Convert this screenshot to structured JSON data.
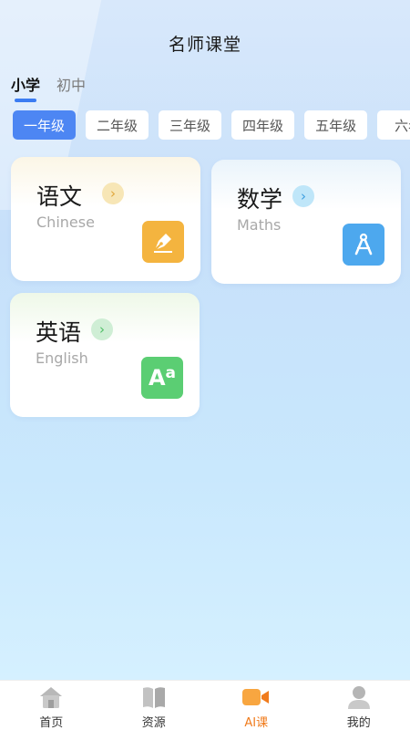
{
  "header": {
    "title": "名师课堂"
  },
  "level_tabs": [
    {
      "label": "小学",
      "active": true
    },
    {
      "label": "初中",
      "active": false
    }
  ],
  "grades": [
    {
      "label": "一年级",
      "active": true
    },
    {
      "label": "二年级",
      "active": false
    },
    {
      "label": "三年级",
      "active": false
    },
    {
      "label": "四年级",
      "active": false
    },
    {
      "label": "五年级",
      "active": false
    },
    {
      "label": "六年",
      "active": false
    }
  ],
  "subjects": [
    {
      "title": "语文",
      "subtitle": "Chinese",
      "icon": "pen-nib-icon",
      "icon_color": "#f4b43f",
      "arrow_color": "#f7d99a"
    },
    {
      "title": "数学",
      "subtitle": "Maths",
      "icon": "compass-icon",
      "icon_color": "#4da8ee",
      "arrow_color": "#8fd0f5"
    },
    {
      "title": "英语",
      "subtitle": "English",
      "icon": "letters-aa-icon",
      "icon_color": "#5bce73",
      "arrow_color": "#a8e4b0"
    }
  ],
  "tabbar": [
    {
      "label": "首页",
      "icon": "home-icon",
      "active": false
    },
    {
      "label": "资源",
      "icon": "book-icon",
      "active": false
    },
    {
      "label": "AI课",
      "icon": "video-camera-icon",
      "active": true
    },
    {
      "label": "我的",
      "icon": "user-icon",
      "active": false
    }
  ],
  "colors": {
    "accent": "#4d86f3",
    "active_tab": "#f07b1c"
  }
}
